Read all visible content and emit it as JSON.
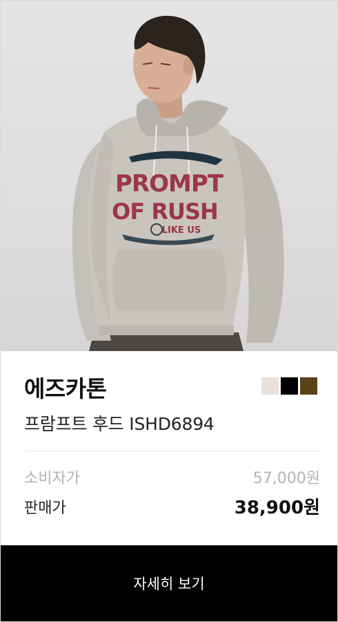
{
  "product": {
    "brand": "에즈카톤",
    "name": "프람프트 후드 ISHD6894",
    "print_text": {
      "line1": "PROMPT",
      "line2": "OF RUSH",
      "badge": "LIKE US"
    },
    "colors": [
      "#e9e1d8",
      "#000000",
      "#5c4317"
    ],
    "price": {
      "retail_label": "소비자가",
      "retail_value": "57,000원",
      "sale_label": "판매가",
      "sale_value": "38,900원"
    }
  },
  "cta": {
    "label": "자세히 보기"
  }
}
